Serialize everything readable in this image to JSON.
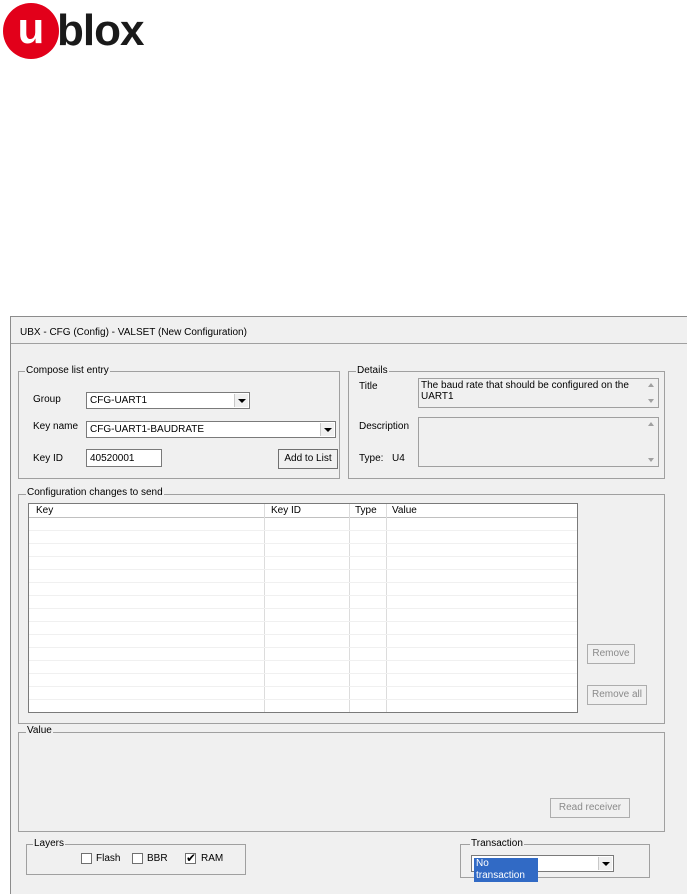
{
  "logo": {
    "letter": "u",
    "text": "blox"
  },
  "dialog": {
    "title": "UBX - CFG (Config) - VALSET (New Configuration)",
    "compose": {
      "legend": "Compose list entry",
      "group_label": "Group",
      "group_value": "CFG-UART1",
      "keyname_label": "Key name",
      "keyname_value": "CFG-UART1-BAUDRATE",
      "keyid_label": "Key ID",
      "keyid_value": "40520001",
      "add_button": "Add to List"
    },
    "details": {
      "legend": "Details",
      "title_label": "Title",
      "title_value": "The baud rate that should be configured on the UART1",
      "description_label": "Description",
      "description_value": "",
      "type_label": "Type:",
      "type_value": "U4"
    },
    "changes": {
      "legend": "Configuration changes to send",
      "columns": [
        "Key",
        "Key ID",
        "Type",
        "Value"
      ],
      "rows": [],
      "remove_button": "Remove",
      "remove_all_button": "Remove all"
    },
    "value": {
      "legend": "Value",
      "read_button": "Read receiver"
    },
    "layers": {
      "legend": "Layers",
      "items": [
        {
          "label": "Flash",
          "checked": false
        },
        {
          "label": "BBR",
          "checked": false
        },
        {
          "label": "RAM",
          "checked": true
        }
      ]
    },
    "transaction": {
      "legend": "Transaction",
      "value": "No transaction"
    }
  }
}
